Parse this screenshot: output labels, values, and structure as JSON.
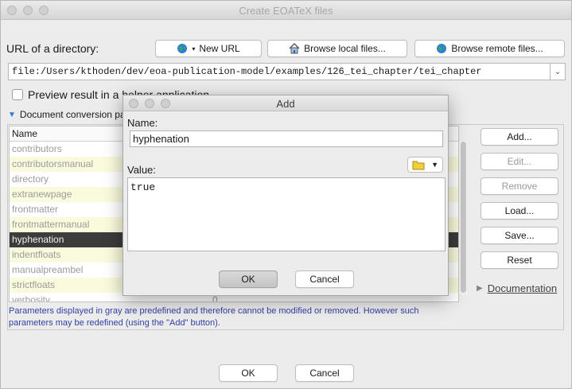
{
  "window": {
    "title": "Create EOATeX files"
  },
  "url_section": {
    "label": "URL of a directory:",
    "new_url_label": "New URL",
    "browse_local_label": "Browse local files...",
    "browse_remote_label": "Browse remote files...",
    "url_value": "file:/Users/kthoden/dev/eoa-publication-model/examples/126_tei_chapter/tei_chapter",
    "dropdown_glyph": "⌄"
  },
  "preview": {
    "label": "Preview result in a helper application",
    "checked": false
  },
  "conversion": {
    "label": "Document conversion parameters"
  },
  "params_table": {
    "header": "Name",
    "rows": [
      {
        "name": "contributors",
        "value": ""
      },
      {
        "name": "contributorsmanual",
        "value": ""
      },
      {
        "name": "directory",
        "value": ""
      },
      {
        "name": "extranewpage",
        "value": ""
      },
      {
        "name": "frontmatter",
        "value": ""
      },
      {
        "name": "frontmattermanual",
        "value": ""
      },
      {
        "name": "hyphenation",
        "value": "",
        "selected": true
      },
      {
        "name": "indentfloats",
        "value": ""
      },
      {
        "name": "manualpreambel",
        "value": ""
      },
      {
        "name": "strictfloats",
        "value": ""
      },
      {
        "name": "verbosity",
        "value": "0"
      }
    ],
    "note": "Parameters displayed in gray are predefined and therefore cannot be modified or removed. However such parameters may be redefined (using the \"Add\" button)."
  },
  "side_buttons": {
    "add": "Add...",
    "edit": "Edit...",
    "remove": "Remove",
    "load": "Load...",
    "save": "Save...",
    "reset": "Reset"
  },
  "documentation_label": "Documentation",
  "footer": {
    "ok": "OK",
    "cancel": "Cancel"
  },
  "dialog": {
    "title": "Add",
    "name_label": "Name:",
    "name_value": "hyphenation",
    "value_label": "Value:",
    "value_text": "true",
    "ok": "OK",
    "cancel": "Cancel"
  },
  "icons": [
    "globe-icon",
    "home-icon",
    "globe-icon",
    "folder-icon",
    "chevron-down-icon",
    "disclosure-triangle-icon"
  ],
  "colors": {
    "selection": "#3c3c3c",
    "alt_row": "#fafadc",
    "note_text": "#3340a6"
  }
}
